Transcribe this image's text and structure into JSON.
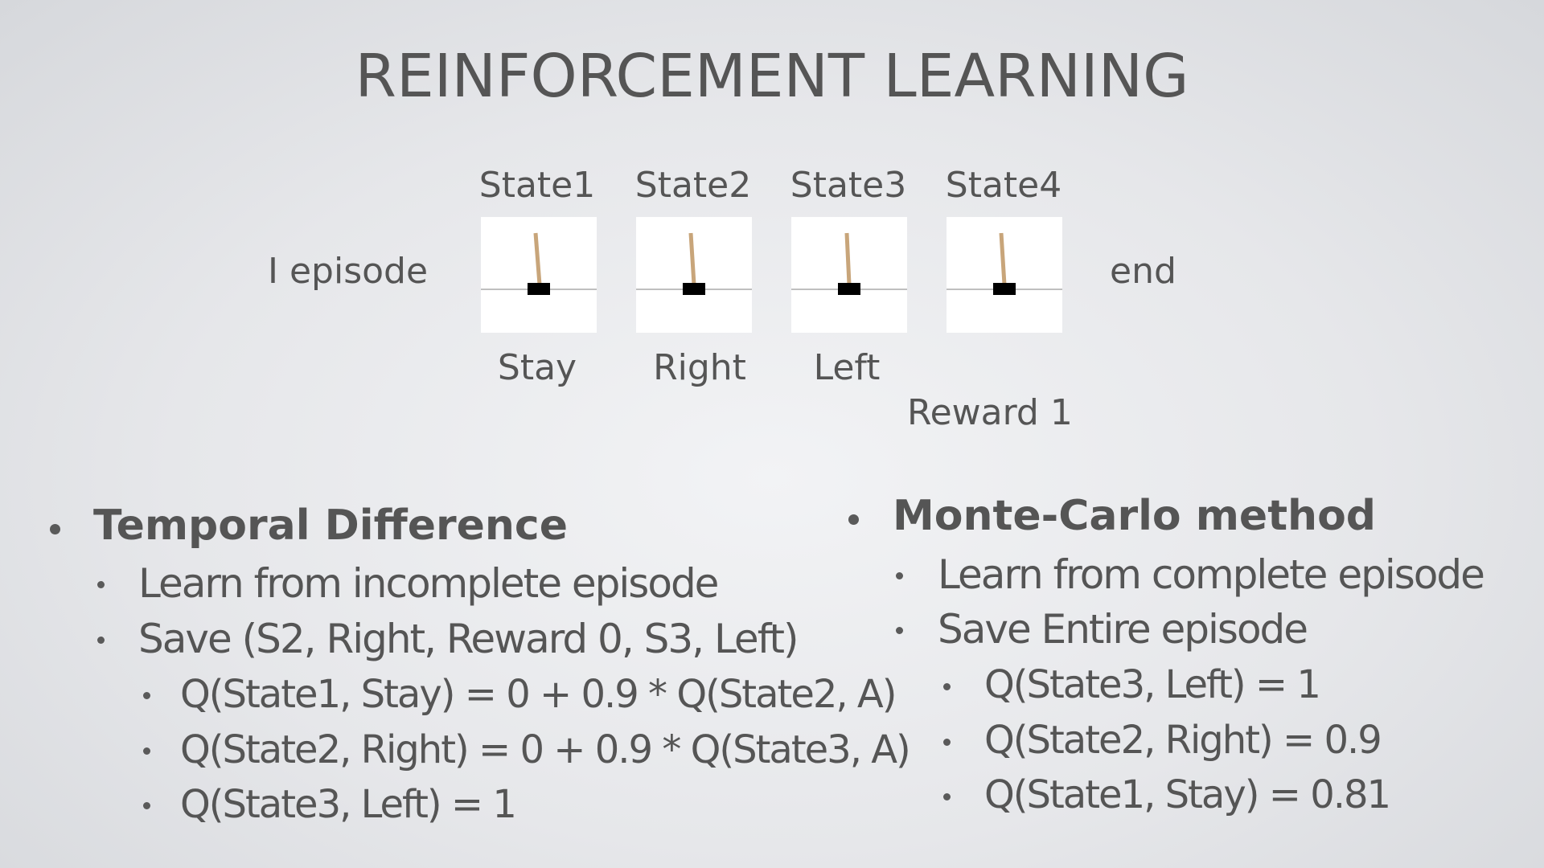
{
  "slide": {
    "title": "REINFORCEMENT LEARNING"
  },
  "episode": {
    "label": "I  episode",
    "end_label": "end",
    "states": [
      {
        "label": "State1",
        "action": "Stay"
      },
      {
        "label": "State2",
        "action": "Right"
      },
      {
        "label": "State3",
        "action": "Left"
      },
      {
        "label": "State4",
        "action": ""
      }
    ],
    "reward_label": "Reward  1"
  },
  "temporal_difference": {
    "heading": "Temporal Difference",
    "items": [
      "Learn from incomplete episode",
      "Save (S2, Right, Reward 0, S3, Left)"
    ],
    "subitems": [
      "Q(State1, Stay) = 0 + 0.9 * Q(State2, A)",
      "Q(State2, Right) = 0 + 0.9 * Q(State3, A)",
      "Q(State3, Left) = 1"
    ]
  },
  "monte_carlo": {
    "heading": "Monte-Carlo method",
    "items": [
      "Learn from complete episode",
      "Save Entire episode"
    ],
    "subitems": [
      "Q(State3, Left) = 1",
      "Q(State2, Right) = 0.9",
      "Q(State1, Stay) = 0.81"
    ]
  },
  "colors": {
    "pole": "#c8a57a",
    "cart": "#000000",
    "track": "#aaaaaa",
    "text": "#555555"
  }
}
